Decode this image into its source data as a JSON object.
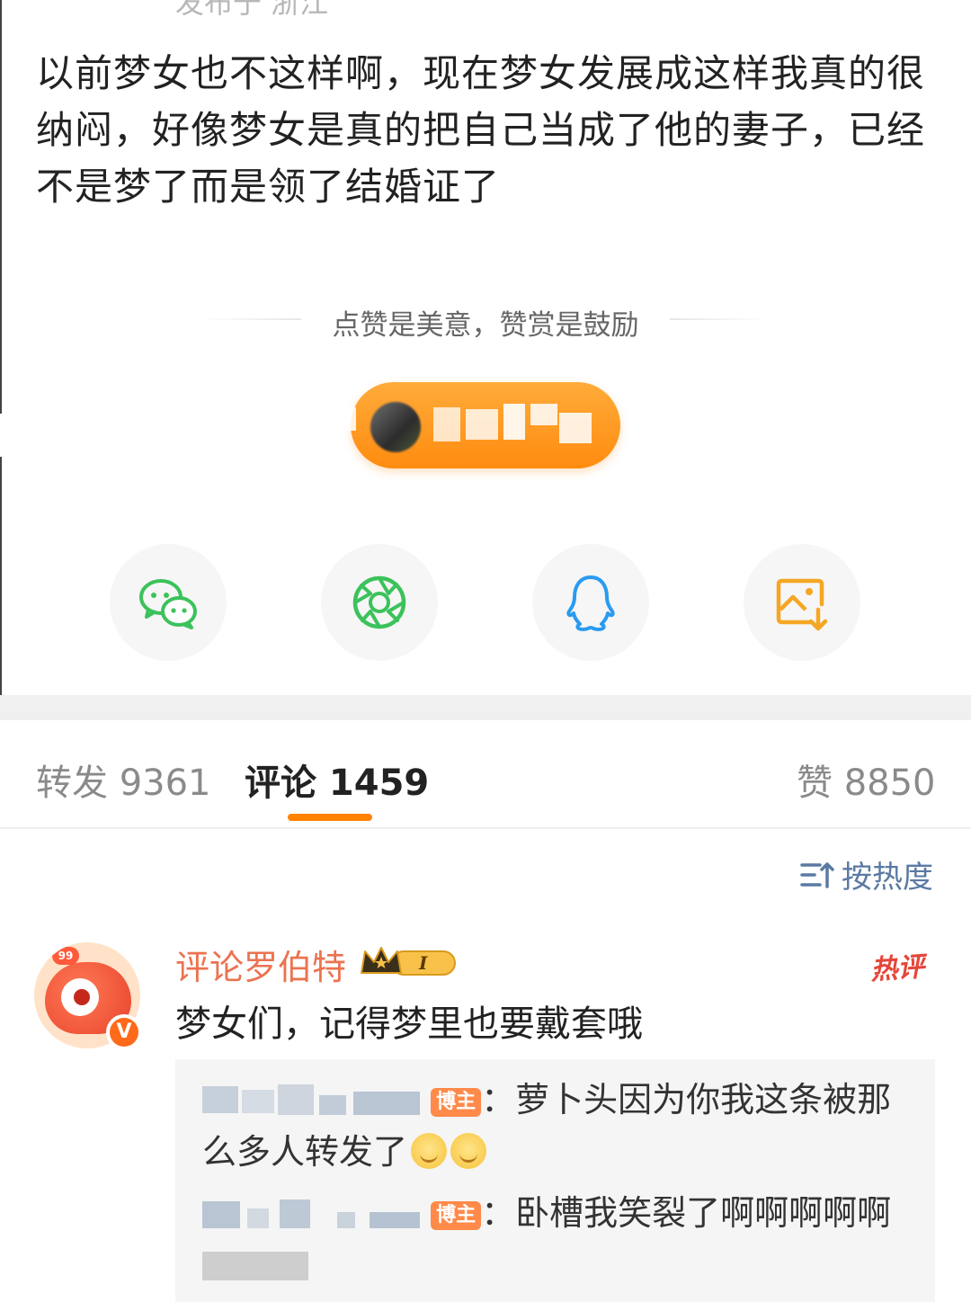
{
  "post": {
    "location_cut": "发布于 浙江",
    "text": "以前梦女也不这样啊，现在梦女发展成这样我真的很纳闷，好像梦女是真的把自己当成了他的妻子，已经不是梦了而是领了结婚证了"
  },
  "reward": {
    "hint": "点赞是美意，赞赏是鼓励"
  },
  "share": [
    {
      "name": "wechat-icon",
      "color": "#3cc25b"
    },
    {
      "name": "moments-icon",
      "color": "#3cc25b"
    },
    {
      "name": "qq-icon",
      "color": "#2a9bf0"
    },
    {
      "name": "save-image-icon",
      "color": "#f5a623"
    }
  ],
  "tabs": {
    "repost": "转发 9361",
    "comment": "评论 1459",
    "like": "赞 8850"
  },
  "sort": {
    "label": "按热度"
  },
  "comment": {
    "username": "评论罗伯特",
    "level_badge": "I",
    "avatar_badge": "99",
    "verified": "V",
    "hot_label": "热评",
    "text": "梦女们，记得梦里也要戴套哦",
    "replies": [
      {
        "author_tag": "博主",
        "text_line1": "：萝卜头因为你我这条被那",
        "text_line2": "么多人转发了"
      },
      {
        "author_tag": "博主",
        "text_line1": "：卧槽我笑裂了啊啊啊啊啊"
      }
    ]
  },
  "colors": {
    "accent": "#ff8200",
    "username": "#eb7350",
    "link_blue": "#5a7aa3"
  }
}
